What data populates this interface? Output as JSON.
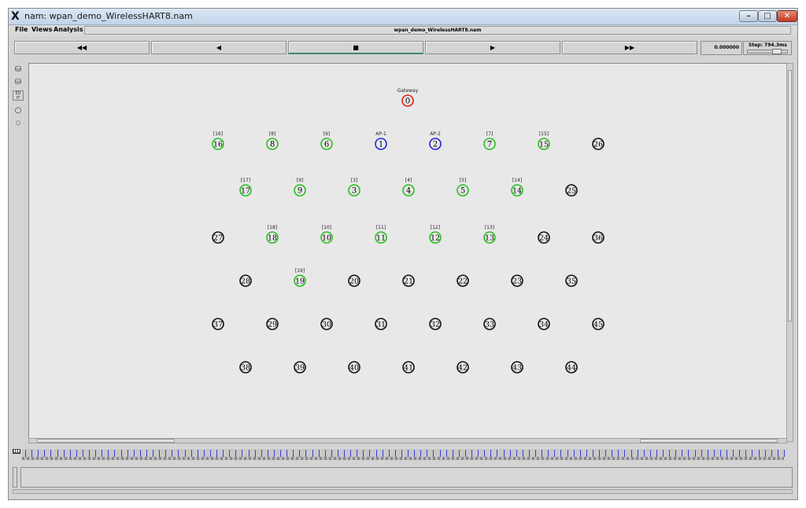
{
  "window": {
    "title": "nam: wpan_demo_WirelessHART8.nam"
  },
  "menubar": {
    "items": [
      "File",
      "Views",
      "Analysis"
    ],
    "filename": "wpan_demo_WirelessHART8.nam"
  },
  "controls": {
    "rewind": "◀◀",
    "back": "◀",
    "stop": "■",
    "play": "▶",
    "fastforward": "▶▶",
    "time": "0.000000",
    "step": "Step: 794.3ms"
  },
  "tools": {
    "edit": "ED IT"
  },
  "colors": {
    "gateway": "#e01b1b",
    "ap": "#1f26d6",
    "active": "#27c01e",
    "idle": "#111111"
  },
  "nodes": [
    {
      "id": "0",
      "label": "Gateway",
      "kind": "gateway"
    },
    {
      "id": "1",
      "label": "AP-1",
      "kind": "ap"
    },
    {
      "id": "2",
      "label": "AP-2",
      "kind": "ap"
    },
    {
      "id": "3",
      "label": "[3]",
      "kind": "active"
    },
    {
      "id": "4",
      "label": "[4]",
      "kind": "active"
    },
    {
      "id": "5",
      "label": "[5]",
      "kind": "active"
    },
    {
      "id": "6",
      "label": "[6]",
      "kind": "active"
    },
    {
      "id": "7",
      "label": "[7]",
      "kind": "active"
    },
    {
      "id": "8",
      "label": "[8]",
      "kind": "active"
    },
    {
      "id": "9",
      "label": "[9]",
      "kind": "active"
    },
    {
      "id": "10",
      "label": "[10]",
      "kind": "active"
    },
    {
      "id": "11",
      "label": "[11]",
      "kind": "active"
    },
    {
      "id": "12",
      "label": "[12]",
      "kind": "active"
    },
    {
      "id": "13",
      "label": "[13]",
      "kind": "active"
    },
    {
      "id": "14",
      "label": "[14]",
      "kind": "active"
    },
    {
      "id": "15",
      "label": "[15]",
      "kind": "active"
    },
    {
      "id": "16",
      "label": "[16]",
      "kind": "active"
    },
    {
      "id": "17",
      "label": "[17]",
      "kind": "active"
    },
    {
      "id": "18",
      "label": "[18]",
      "kind": "active"
    },
    {
      "id": "19",
      "label": "[19]",
      "kind": "active"
    },
    {
      "id": "20",
      "label": "",
      "kind": "idle"
    },
    {
      "id": "21",
      "label": "",
      "kind": "idle"
    },
    {
      "id": "22",
      "label": "",
      "kind": "idle"
    },
    {
      "id": "23",
      "label": "",
      "kind": "idle"
    },
    {
      "id": "24",
      "label": "",
      "kind": "idle"
    },
    {
      "id": "25",
      "label": "",
      "kind": "idle"
    },
    {
      "id": "26",
      "label": "",
      "kind": "idle"
    },
    {
      "id": "27",
      "label": "",
      "kind": "idle"
    },
    {
      "id": "28",
      "label": "",
      "kind": "idle"
    },
    {
      "id": "29",
      "label": "",
      "kind": "idle"
    },
    {
      "id": "30",
      "label": "",
      "kind": "idle"
    },
    {
      "id": "31",
      "label": "",
      "kind": "idle"
    },
    {
      "id": "32",
      "label": "",
      "kind": "idle"
    },
    {
      "id": "33",
      "label": "",
      "kind": "idle"
    },
    {
      "id": "34",
      "label": "",
      "kind": "idle"
    },
    {
      "id": "35",
      "label": "",
      "kind": "idle"
    },
    {
      "id": "36",
      "label": "",
      "kind": "idle"
    },
    {
      "id": "37",
      "label": "",
      "kind": "idle"
    },
    {
      "id": "38",
      "label": "",
      "kind": "idle"
    },
    {
      "id": "39",
      "label": "",
      "kind": "idle"
    },
    {
      "id": "40",
      "label": "",
      "kind": "idle"
    },
    {
      "id": "41",
      "label": "",
      "kind": "idle"
    },
    {
      "id": "42",
      "label": "",
      "kind": "idle"
    },
    {
      "id": "43",
      "label": "",
      "kind": "idle"
    },
    {
      "id": "44",
      "label": "",
      "kind": "idle"
    },
    {
      "id": "45",
      "label": "",
      "kind": "idle"
    }
  ]
}
